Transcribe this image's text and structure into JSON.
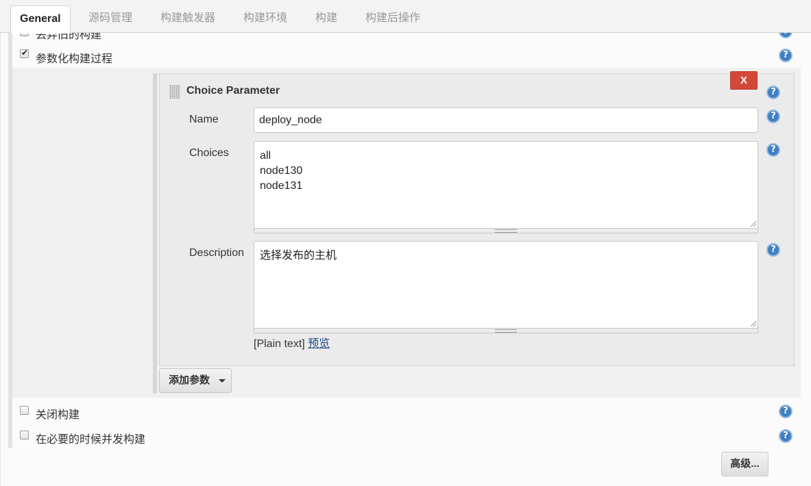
{
  "tabs": [
    {
      "label": "General",
      "active": true
    },
    {
      "label": "源码管理",
      "active": false
    },
    {
      "label": "构建触发器",
      "active": false
    },
    {
      "label": "构建环境",
      "active": false
    },
    {
      "label": "构建",
      "active": false
    },
    {
      "label": "构建后操作",
      "active": false
    }
  ],
  "options": {
    "discard_old_builds": {
      "label": "丢弃旧的构建",
      "checked": false
    },
    "parameterized": {
      "label": "参数化构建过程",
      "checked": true
    },
    "disable_build": {
      "label": "关闭构建",
      "checked": false
    },
    "concurrent_build": {
      "label": "在必要的时候并发构建",
      "checked": false
    }
  },
  "parameter": {
    "title": "Choice Parameter",
    "delete_label": "X",
    "name_label": "Name",
    "name_value": "deploy_node",
    "choices_label": "Choices",
    "choices_value": "all\nnode130\nnode131",
    "description_label": "Description",
    "description_value": "选择发布的主机",
    "format_text": "[Plain text]",
    "preview_link": "预览"
  },
  "add_param_label": "添加参数",
  "advanced_label": "高级...",
  "help_symbol": "?",
  "colors": {
    "delete_button": "#d24939",
    "help_icon": "#3f7fc2",
    "link": "#204a87"
  }
}
